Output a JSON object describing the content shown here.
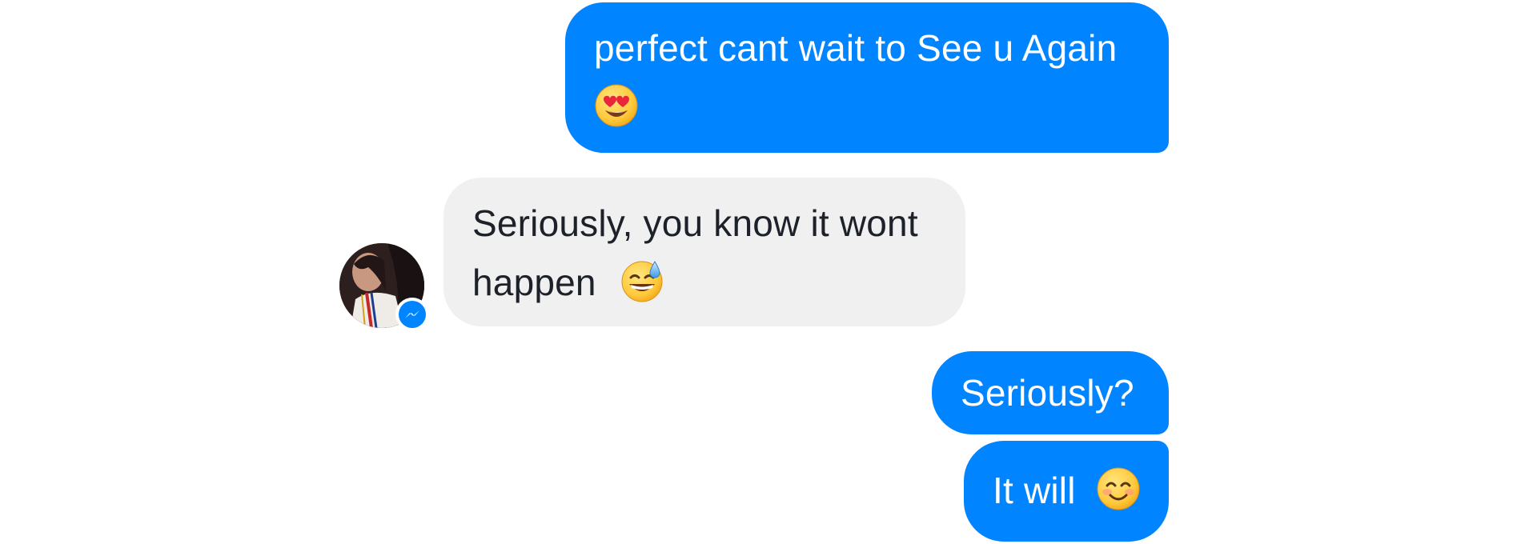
{
  "conversation": {
    "messages": [
      {
        "direction": "outgoing",
        "line1": "perfect cant wait to See u Again",
        "emoji": "heart-eyes-emoji"
      },
      {
        "direction": "incoming",
        "line1": "Seriously, you know it wont",
        "line2": "happen",
        "emoji": "sweat-smile-emoji"
      },
      {
        "direction": "outgoing",
        "text": "Seriously?"
      },
      {
        "direction": "outgoing",
        "text": "It will",
        "emoji": "smiling-face-emoji"
      }
    ],
    "contact_avatar": {
      "icon": "contact-avatar",
      "badge_icon": "messenger-badge-icon"
    }
  },
  "colors": {
    "outgoing_bubble": "#0084ff",
    "incoming_bubble": "#f1f0f0",
    "outgoing_text": "#ffffff",
    "incoming_text": "#1d2129"
  }
}
